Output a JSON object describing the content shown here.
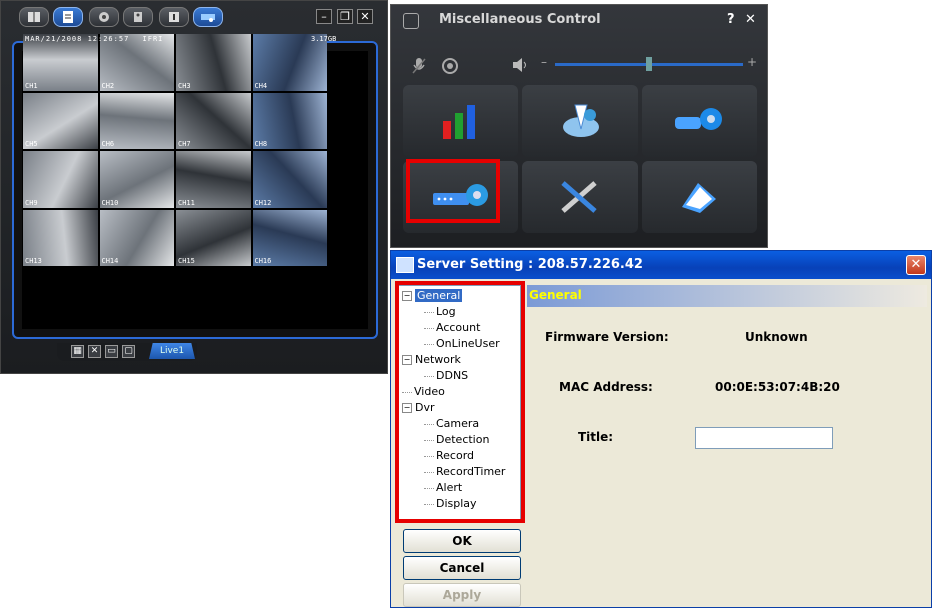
{
  "viewer": {
    "osd_date": "MAR/21/2008 12:26:57",
    "osd_flag": "IFRI",
    "osd_hdd": "3.17GB",
    "channels": [
      "CH1",
      "CH2",
      "CH3",
      "CH4",
      "CH5",
      "CH6",
      "CH7",
      "CH8",
      "CH9",
      "CH10",
      "CH11",
      "CH12",
      "CH13",
      "CH14",
      "CH15",
      "CH16"
    ],
    "live_tab": "Live1",
    "colors": {
      "frame": "#2c6ad6",
      "active_button": "#3a7bd5"
    }
  },
  "misc": {
    "title": "Miscellaneous Control",
    "help": "?",
    "close": "✕",
    "volume_minus": "–",
    "volume_plus": "+",
    "volume_level": 0.5,
    "icons": [
      "bar-chart-icon",
      "network-setup-icon",
      "camera-setup-icon",
      "server-setting-icon",
      "tools-icon",
      "log-icon"
    ]
  },
  "dialog": {
    "title": "Server Setting : 208.57.226.42",
    "close": "✕",
    "tree": [
      {
        "label": "General",
        "level": 0,
        "expander": "−",
        "selected": true
      },
      {
        "label": "Log",
        "level": 1
      },
      {
        "label": "Account",
        "level": 1
      },
      {
        "label": "OnLineUser",
        "level": 1
      },
      {
        "label": "Network",
        "level": 0,
        "expander": "−"
      },
      {
        "label": "DDNS",
        "level": 1
      },
      {
        "label": "Video",
        "level": 0
      },
      {
        "label": "Dvr",
        "level": 0,
        "expander": "−"
      },
      {
        "label": "Camera",
        "level": 1
      },
      {
        "label": "Detection",
        "level": 1
      },
      {
        "label": "Record",
        "level": 1
      },
      {
        "label": "RecordTimer",
        "level": 1
      },
      {
        "label": "Alert",
        "level": 1
      },
      {
        "label": "Display",
        "level": 1
      }
    ],
    "buttons": {
      "ok": "OK",
      "cancel": "Cancel",
      "apply": "Apply"
    },
    "panel": {
      "header": "General",
      "firmware_label": "Firmware Version:",
      "firmware_value": "Unknown",
      "mac_label": "MAC Address:",
      "mac_value": "00:0E:53:07:4B:20",
      "title_label": "Title:",
      "title_value": ""
    },
    "colors": {
      "title_bar": "#0a5fe2",
      "highlight": "#e60000",
      "header_text": "#ffff00"
    }
  }
}
